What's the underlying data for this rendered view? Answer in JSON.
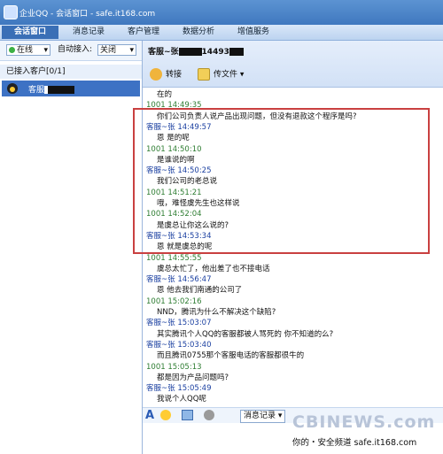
{
  "window": {
    "title": "企业QQ - 会话窗口 - safe.it168.com"
  },
  "tabs": [
    {
      "label": "会话窗口"
    },
    {
      "label": "消息记录"
    },
    {
      "label": "客户管理"
    },
    {
      "label": "数据分析"
    },
    {
      "label": "增值服务"
    }
  ],
  "sidebar": {
    "status_value": "在线",
    "auto_accept_label": "自动接入:",
    "auto_accept_value": "关闭",
    "group_header": "已接入客户[0/1]",
    "contact_name": "客服"
  },
  "chat_header": {
    "name": "客服~张",
    "number": "14493",
    "transfer_label": "转接",
    "send_file_label": "传文件"
  },
  "messages": [
    {
      "kind": "body",
      "text": "在的"
    },
    {
      "kind": "head",
      "speaker": "cust",
      "text": "1001   14:49:35"
    },
    {
      "kind": "body",
      "text": "你们公司负责人说产品出现问题，但没有退款这个程序是吗?"
    },
    {
      "kind": "head",
      "speaker": "cs",
      "text": "客服~张        14:49:57"
    },
    {
      "kind": "body",
      "text": "恩 是的呢"
    },
    {
      "kind": "head",
      "speaker": "cust",
      "text": "1001   14:50:10"
    },
    {
      "kind": "body",
      "text": "是谁说的啊"
    },
    {
      "kind": "head",
      "speaker": "cs",
      "text": "客服~张        14:50:25"
    },
    {
      "kind": "body",
      "text": "我们公司的老总说"
    },
    {
      "kind": "head",
      "speaker": "cust",
      "text": "1001   14:51:21"
    },
    {
      "kind": "body",
      "text": "哦，难怪虞先生也这样说"
    },
    {
      "kind": "head",
      "speaker": "cust",
      "text": "1001   14:52:04"
    },
    {
      "kind": "body",
      "text": "是虞总让你这么说的?"
    },
    {
      "kind": "head",
      "speaker": "cs",
      "text": "客服~张        14:53:34"
    },
    {
      "kind": "body",
      "text": "恩 就是虞总的呢"
    },
    {
      "kind": "head",
      "speaker": "cust",
      "text": "1001   14:55:55"
    },
    {
      "kind": "body",
      "text": "虞总太忙了，他出差了也不接电话"
    },
    {
      "kind": "head",
      "speaker": "cs",
      "text": "客服~张        14:56:47"
    },
    {
      "kind": "body",
      "text": "恩  他去我们南通的公司了"
    },
    {
      "kind": "head",
      "speaker": "cust",
      "text": "1001   15:02:16"
    },
    {
      "kind": "body",
      "text": "NND，腾讯为什么不解决这个缺陷?"
    },
    {
      "kind": "head",
      "speaker": "cs",
      "text": "客服~张        15:03:07"
    },
    {
      "kind": "body",
      "text": "其实腾讯个人QQ的客服都被人骂死的 你不知道的么?"
    },
    {
      "kind": "head",
      "speaker": "cs",
      "text": "客服~张        15:03:40"
    },
    {
      "kind": "body",
      "text": "而且腾讯0755那个客服电话的客服都很牛的"
    },
    {
      "kind": "head",
      "speaker": "cust",
      "text": "1001   15:05:13"
    },
    {
      "kind": "body",
      "text": "都是因为产品问题吗?"
    },
    {
      "kind": "head",
      "speaker": "cs",
      "text": "客服~张        15:05:49"
    },
    {
      "kind": "body",
      "text": "我说个人QQ呢"
    }
  ],
  "toolbar": {
    "history_label": "消息记录"
  },
  "watermark": "CBINEWS.com",
  "footer": "你的・安全频道  safe.it168.com"
}
